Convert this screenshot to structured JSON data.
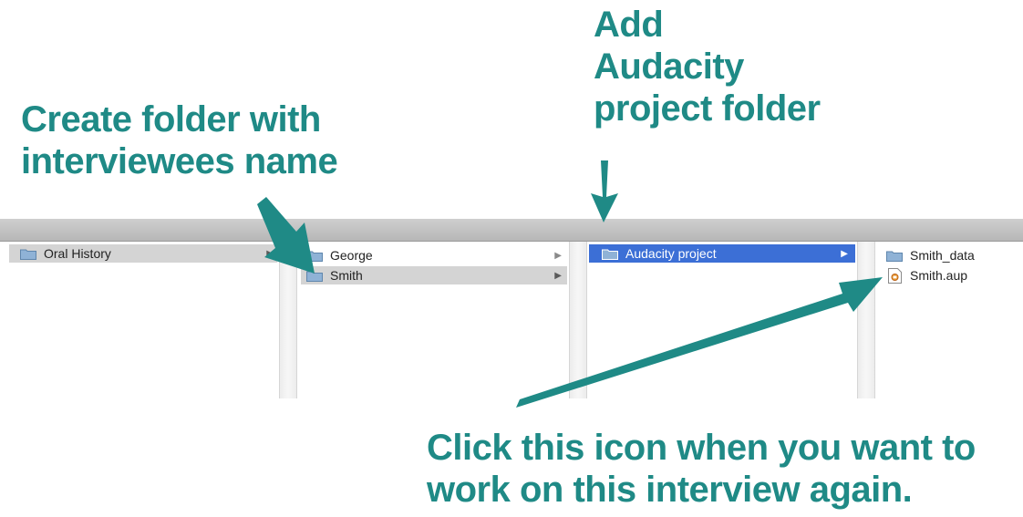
{
  "annotations": {
    "add_project": [
      "Add",
      "Audacity",
      "project folder"
    ],
    "create_folder": [
      "Create folder with",
      "interviewees name"
    ],
    "click_icon": [
      "Click this icon when you want to",
      "work on this interview again."
    ]
  },
  "colors": {
    "annotation_teal": "#1f8a86",
    "selection_blue": "#3c6fd6",
    "selection_gray": "#d4d4d4",
    "folder_blue": "#8fb2d6"
  },
  "browser": {
    "columns": [
      {
        "items": [
          {
            "label": "Oral History",
            "icon": "folder-icon",
            "selected": "gray",
            "has_children": true
          }
        ]
      },
      {
        "items": [
          {
            "label": "George",
            "icon": "folder-icon",
            "selected": "none",
            "has_children": true
          },
          {
            "label": "Smith",
            "icon": "folder-icon",
            "selected": "gray",
            "has_children": true
          }
        ]
      },
      {
        "items": [
          {
            "label": "Audacity project",
            "icon": "folder-icon",
            "selected": "blue",
            "has_children": true
          }
        ]
      },
      {
        "items": [
          {
            "label": "Smith_data",
            "icon": "folder-icon",
            "selected": "none",
            "has_children": false
          },
          {
            "label": "Smith.aup",
            "icon": "audacity-file-icon",
            "selected": "none",
            "has_children": false
          }
        ]
      }
    ]
  }
}
